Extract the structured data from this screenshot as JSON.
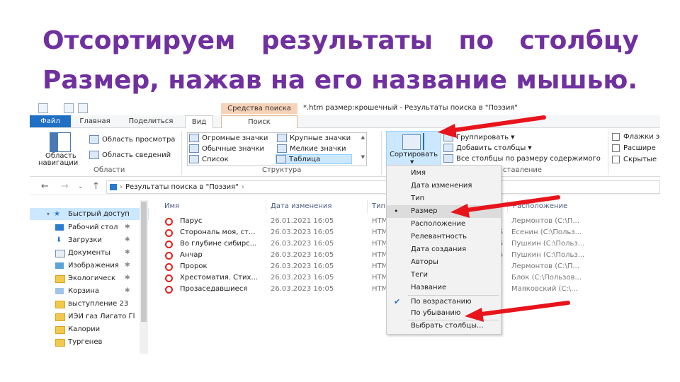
{
  "heading": {
    "line1_words": [
      "Отсортируем",
      "результаты",
      "по",
      "столбцу"
    ],
    "line2": "Размер, нажав на его название мышью."
  },
  "window": {
    "title": "*.htm размер:крошечный - Результаты поиска в \"Поэзия\"",
    "context_tab": "Средства поиска"
  },
  "ribbon_tabs": [
    "Файл",
    "Главная",
    "Поделиться",
    "Вид",
    "Поиск"
  ],
  "ribbon": {
    "nav_pane_label_1": "Область",
    "nav_pane_label_2": "навигации",
    "preview_pane": "Область просмотра",
    "details_pane": "Область сведений",
    "group_areas": "Области",
    "layout": {
      "extra_large": "Огромные значки",
      "large": "Крупные значки",
      "medium": "Обычные значки",
      "small": "Мелкие значки",
      "list": "Список",
      "details": "Таблица"
    },
    "group_structure": "Структура",
    "sort_label": "Сортировать",
    "group_by": "Группировать",
    "add_columns": "Добавить столбцы",
    "fit_columns": "Все столбцы по размеру содержимого",
    "group_view": "ставление",
    "checkboxes": [
      "Флажки э",
      "Расшире",
      "Скрытые"
    ]
  },
  "address": {
    "path": "Результаты поиска в \"Поэзия\""
  },
  "nav_items": [
    {
      "label": "Быстрый доступ",
      "icon": "star-icon",
      "pinned": false
    },
    {
      "label": "Рабочий стол",
      "icon": "desktop-icon",
      "pinned": true
    },
    {
      "label": "Загрузки",
      "icon": "download-icon",
      "pinned": true
    },
    {
      "label": "Документы",
      "icon": "documents-icon",
      "pinned": true
    },
    {
      "label": "Изображения",
      "icon": "pictures-icon",
      "pinned": true
    },
    {
      "label": "Экологическ",
      "icon": "folder-icon",
      "pinned": true
    },
    {
      "label": "Корзина",
      "icon": "recycle-bin-icon",
      "pinned": true
    },
    {
      "label": "выступление 23",
      "icon": "folder-icon",
      "pinned": false
    },
    {
      "label": "ИЭИ газ Лигато Гl",
      "icon": "folder-icon",
      "pinned": false
    },
    {
      "label": "Калории",
      "icon": "folder-icon",
      "pinned": false
    },
    {
      "label": "Тургенев",
      "icon": "folder-icon",
      "pinned": false
    }
  ],
  "columns": [
    "Имя",
    "Дата изменения",
    "Тип",
    "Расположение"
  ],
  "rows": [
    {
      "name": "Парус",
      "date": "26.01.2021 16:05",
      "type": "HTM",
      "x": "",
      "loc": "Лермонтов (С:\\П..."
    },
    {
      "name": "Сторональ моя, ст...",
      "date": "26.03.2023 16:05",
      "type": "HTM",
      "x": "5",
      "loc": "Есенин (С:\\Польз..."
    },
    {
      "name": "Во глубине сибирс...",
      "date": "26.03.2023 16:05",
      "type": "HTM",
      "x": "5",
      "loc": "Пушкин (С:\\Польз..."
    },
    {
      "name": "Анчар",
      "date": "26.03.2023 16:05",
      "type": "HTM",
      "x": "5",
      "loc": "Пушкин (С:\\Польз..."
    },
    {
      "name": "Пророк",
      "date": "26.03.2023 16:05",
      "type": "HTM",
      "x": "",
      "loc": "Лермонтов (С:\\П..."
    },
    {
      "name": "Хрестоматия. Стих...",
      "date": "26.03.2023 16:05",
      "type": "HTM",
      "x": "",
      "loc": "Блок (С:\\Пользов..."
    },
    {
      "name": "Прозаседавшиеся",
      "date": "26.03.2023 16:05",
      "type": "HTM",
      "x": "",
      "loc": "Маяковский (С:\\..."
    }
  ],
  "sort_menu": {
    "items": [
      "Имя",
      "Дата изменения",
      "Тип",
      "Размер",
      "Расположение",
      "Релевантность",
      "Дата создания",
      "Авторы",
      "Теги",
      "Название"
    ],
    "selected_index": 3,
    "ascending": "По возрастанию",
    "descending": "По убыванию",
    "choose_columns": "Выбрать столбцы..."
  },
  "colors": {
    "heading": "#7030a0",
    "arrow": "#e8141c",
    "file_tab": "#1f6fc5",
    "selection": "#cce8ff"
  }
}
